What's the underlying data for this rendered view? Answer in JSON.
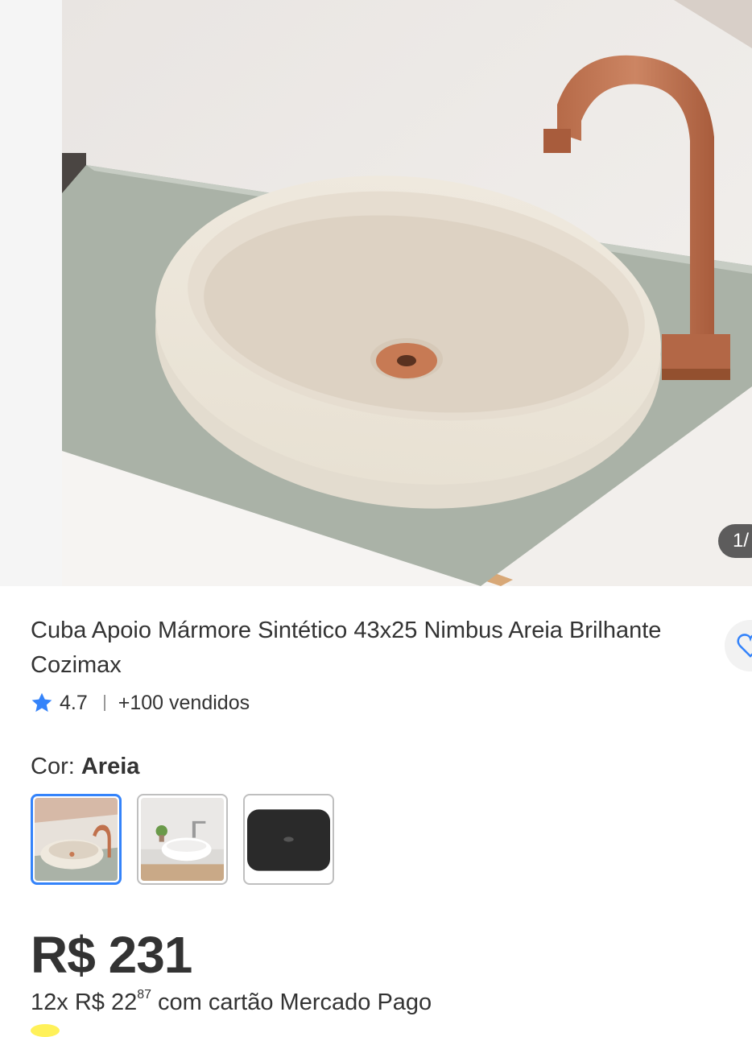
{
  "gallery": {
    "image_description_icon": "sink-product-photo",
    "counter": "1/"
  },
  "product": {
    "title": "Cuba Apoio Mármore Sintético 43x25 Nimbus Areia Brilhante Cozimax",
    "rating": "4.7",
    "sold": "+100 vendidos"
  },
  "color_selector": {
    "label": "Cor: ",
    "value": "Areia",
    "options_count": 3
  },
  "price": {
    "main": "R$ 231",
    "installment_prefix": "12x R$ 22",
    "installment_cents": "87",
    "installment_suffix": " com cartão Mercado Pago"
  },
  "colors": {
    "accent": "#3483fa",
    "text": "#333333"
  }
}
